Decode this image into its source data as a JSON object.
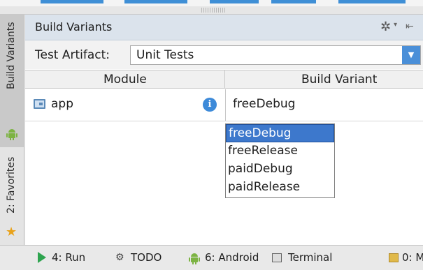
{
  "left_stripe": {
    "build_variants_tab": "Build Variants",
    "favorites_tab": "2: Favorites"
  },
  "panel": {
    "title": "Build Variants",
    "test_artifact_label": "Test Artifact:",
    "test_artifact_value": "Unit Tests",
    "columns": [
      "Module",
      "Build Variant"
    ],
    "rows": [
      {
        "module": "app",
        "build_variant": "freeDebug"
      }
    ],
    "dropdown_options": [
      "freeDebug",
      "freeRelease",
      "paidDebug",
      "paidRelease"
    ],
    "dropdown_selected": "freeDebug"
  },
  "bottom_bar": {
    "run": "4: Run",
    "todo": "TODO",
    "android": "6: Android",
    "terminal": "Terminal",
    "messages": "0: M"
  },
  "icons": {
    "build_variants_tab": "android-icon",
    "favorites_tab": "star-icon",
    "settings": "gear-icon",
    "hide": "hide-panel-icon",
    "module": "module-folder-icon",
    "info": "info-icon",
    "run": "run-icon",
    "todo": "todo-icon",
    "android": "android-icon",
    "terminal": "terminal-icon",
    "messages": "messages-icon"
  },
  "colors": {
    "header_bg": "#dbe3ec",
    "selection": "#3d78cc",
    "accent": "#4a8fd8",
    "run_green": "#2ea44f",
    "android_green": "#7cb342",
    "favorite_star": "#e8a21a"
  }
}
